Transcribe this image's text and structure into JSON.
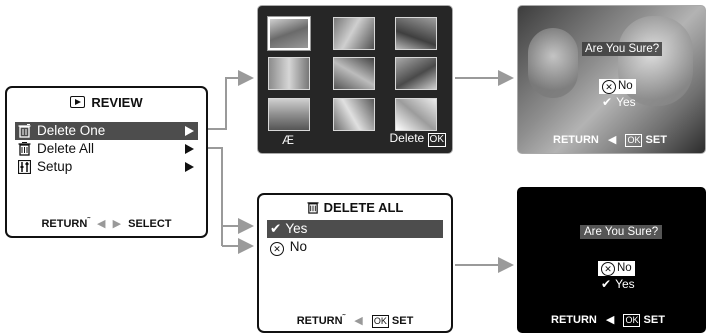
{
  "review_menu": {
    "title": "REVIEW",
    "items": [
      {
        "label": "Delete One"
      },
      {
        "label": "Delete All"
      },
      {
        "label": "Setup"
      }
    ],
    "footer_return": "RETURN",
    "footer_select": "SELECT"
  },
  "thumbnail_screen": {
    "footer_left": "Æ",
    "footer_delete": "Delete",
    "footer_ok": "OK"
  },
  "confirm_photo_screen": {
    "question": "Are You Sure?",
    "no_label": "No",
    "yes_label": "Yes",
    "footer_return": "RETURN",
    "footer_ok": "OK",
    "footer_set": "SET"
  },
  "delete_all_screen": {
    "title": "DELETE ALL",
    "options": [
      {
        "label": "Yes"
      },
      {
        "label": "No"
      }
    ],
    "footer_return": "RETURN",
    "footer_ok": "OK",
    "footer_set": "SET"
  },
  "confirm_black_screen": {
    "question": "Are You Sure?",
    "no_label": "No",
    "yes_label": "Yes",
    "footer_return": "RETURN",
    "footer_ok": "OK",
    "footer_set": "SET"
  },
  "colors": {
    "selection_bar": "#4d4d4d",
    "connector": "#9a9a9a",
    "screen_dark": "#262626"
  }
}
